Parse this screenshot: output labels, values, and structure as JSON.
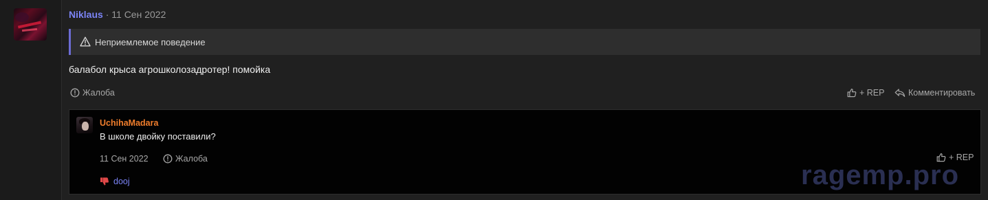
{
  "post": {
    "author": "Niklaus",
    "separator": "·",
    "date": "11 Сен 2022",
    "warning": {
      "icon": "warning-triangle-icon",
      "text": "Неприемлемое поведение",
      "accent_color": "#6c6cd4"
    },
    "body": "балабол крыса агрошколозадротер! помойка",
    "actions": {
      "report": "Жалоба",
      "rep": "+ REP",
      "comment": "Комментировать"
    }
  },
  "comment": {
    "author": "UchihaMadara",
    "author_color": "#ef7d2c",
    "text": "В школе двойку поставили?",
    "date": "11 Сен 2022",
    "report": "Жалоба",
    "rep": "+ REP",
    "reaction": {
      "icon": "thumbs-down-icon",
      "user": "dooj"
    }
  },
  "watermark": "ragemp.pro",
  "colors": {
    "link_blue": "#7b84f6",
    "background": "#202020",
    "comment_bg": "#020202"
  }
}
